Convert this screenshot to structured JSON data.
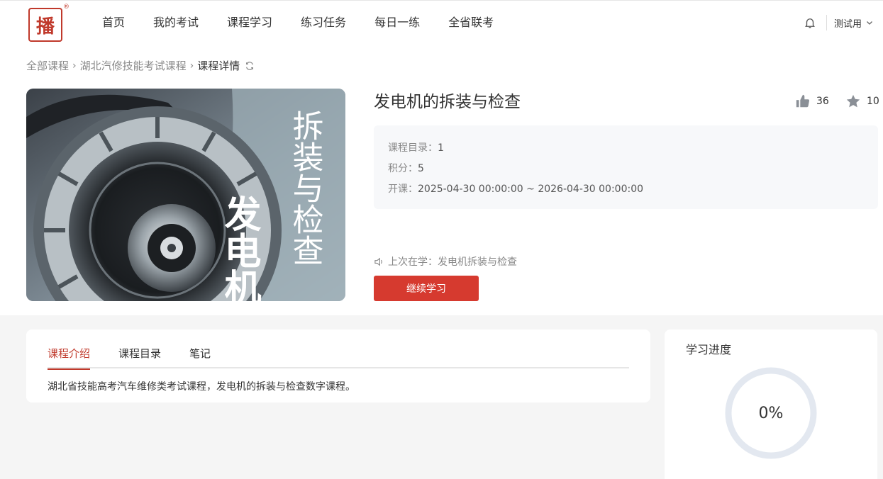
{
  "header": {
    "logo_text": "播",
    "nav": [
      "首页",
      "我的考试",
      "课程学习",
      "练习任务",
      "每日一练",
      "全省联考"
    ],
    "user_name": "测试用"
  },
  "breadcrumb": {
    "items": [
      "全部课程",
      "湖北汽修技能考试课程"
    ],
    "current": "课程详情"
  },
  "cover": {
    "big_text": "发电机",
    "side_text": "拆装与检查"
  },
  "course": {
    "title": "发电机的拆装与检查",
    "likes": "36",
    "favorites": "10",
    "catalog_label": "课程目录：",
    "catalog_value": "1",
    "points_label": "积分：",
    "points_value": "5",
    "period_label": "开课：",
    "period_value": "2025-04-30 00:00:00 ~ 2026-04-30 00:00:00",
    "last_study_label": "上次在学：",
    "last_study_value": "发电机拆装与检查",
    "continue_label": "继续学习"
  },
  "tabs": [
    "课程介绍",
    "课程目录",
    "笔记"
  ],
  "intro_text": "湖北省技能高考汽车维修类考试课程，发电机的拆装与检查数字课程。",
  "progress": {
    "title": "学习进度",
    "value": 0,
    "value_text": "0%"
  },
  "colors": {
    "accent": "#d63a2f",
    "ring_track": "#e3e8f0"
  }
}
